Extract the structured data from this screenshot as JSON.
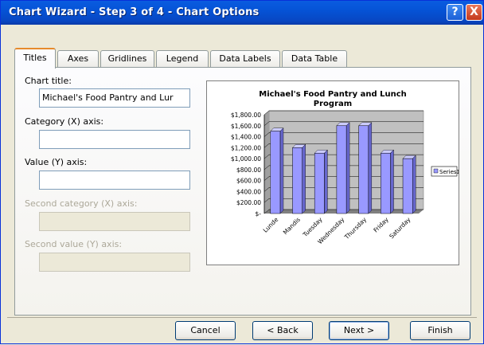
{
  "window": {
    "title": "Chart Wizard - Step 3 of 4 - Chart Options",
    "help_label": "?",
    "close_label": "X"
  },
  "tabs": [
    {
      "label": "Titles",
      "active": true
    },
    {
      "label": "Axes"
    },
    {
      "label": "Gridlines"
    },
    {
      "label": "Legend"
    },
    {
      "label": "Data Labels"
    },
    {
      "label": "Data Table"
    }
  ],
  "form": {
    "chart_title_label": "Chart title:",
    "chart_title_value": "Michael's Food Pantry and Lur",
    "category_x_label": "Category (X) axis:",
    "category_x_value": "",
    "value_y_label": "Value (Y) axis:",
    "value_y_value": "",
    "second_category_label": "Second category (X) axis:",
    "second_value_label": "Second value (Y) axis:"
  },
  "chart_data": {
    "type": "bar",
    "title_line1": "Michael's Food Pantry and Lunch",
    "title_line2": "Program",
    "categories": [
      "Lunde",
      "Mandis",
      "Tuesday",
      "Wednesday",
      "Thursday",
      "Friday",
      "Saturday"
    ],
    "series": [
      {
        "name": "Series1",
        "values": [
          1500,
          1200,
          1100,
          1600,
          1600,
          1100,
          1000
        ]
      }
    ],
    "ylim": [
      0,
      1800
    ],
    "yticks": [
      "$1,800.00",
      "$1,600.00",
      "$1,400.00",
      "$1,200.00",
      "$1,000.00",
      "$800.00",
      "$600.00",
      "$400.00",
      "$200.00",
      "$-"
    ],
    "legend": "right",
    "bar_color": "#9999ff",
    "plot_bg": "#c0c0c0"
  },
  "buttons": {
    "cancel": "Cancel",
    "back": "< Back",
    "next": "Next >",
    "finish": "Finish"
  }
}
